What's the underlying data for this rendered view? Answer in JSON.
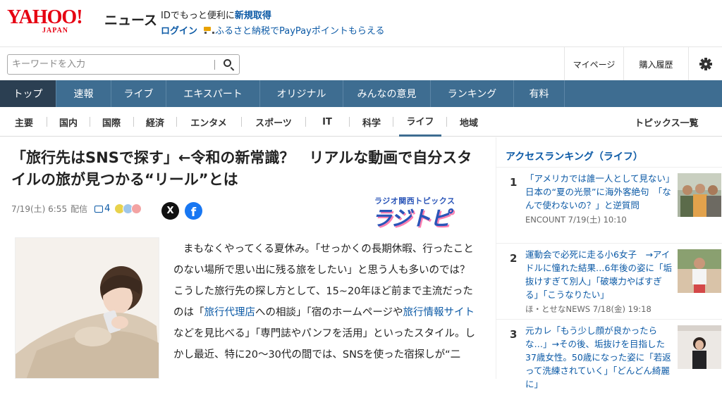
{
  "header": {
    "logo_main": "YAHOO!",
    "logo_sub": "JAPAN",
    "logo_section": "ニュース",
    "promo_prefix": "IDでもっと便利に",
    "promo_link": "新規取得",
    "login": "ログイン",
    "furusato": "ふるさと納税でPayPayポイントもらえる"
  },
  "search": {
    "placeholder": "キーワードを入力"
  },
  "utility": {
    "mypage": "マイページ",
    "history": "購入履歴",
    "settings_icon": "gear-icon"
  },
  "main_nav": [
    {
      "label": "トップ"
    },
    {
      "label": "速報"
    },
    {
      "label": "ライブ"
    },
    {
      "label": "エキスパート"
    },
    {
      "label": "オリジナル"
    },
    {
      "label": "みんなの意見"
    },
    {
      "label": "ランキング"
    },
    {
      "label": "有料"
    }
  ],
  "category_nav": [
    {
      "label": "主要"
    },
    {
      "label": "国内"
    },
    {
      "label": "国際"
    },
    {
      "label": "経済"
    },
    {
      "label": "エンタメ"
    },
    {
      "label": "スポーツ"
    },
    {
      "label": "IT"
    },
    {
      "label": "科学"
    },
    {
      "label": "ライフ"
    },
    {
      "label": "地域"
    }
  ],
  "topics_link": "トピックス一覧",
  "article": {
    "headline": "「旅行先はSNSで探す」←令和の新常識？　リアルな動画で自分スタイルの旅が見つかる“リール”とは",
    "date": "7/19(土) 6:55",
    "date_suffix": "配信",
    "comment_count": "4",
    "source_small": "ラジオ関西トピックス",
    "source_big": "ラジトピ",
    "body_parts": [
      "まもなくやってくる夏休み。「せっかくの長期休暇、行ったことのない場所で思い出に残る旅をしたい」と思う人も多いのでは？　こうした旅行先の探し方として、15~20年ほど前まで主流だったのは「",
      "旅行代理店",
      "への相談」「宿のホームページや",
      "旅行情報サイト",
      "などを見比べる」「専門誌やパンフを活用」といったスタイル。しかし最近、特に20～30代の間では、SNSを使った宿探しが“二"
    ]
  },
  "sidebar": {
    "title": "アクセスランキング（ライフ）",
    "items": [
      {
        "rank": "1",
        "title": "「アメリカでは誰一人として見ない」　日本の“夏の光景”に海外客絶句　「なんで使わないの？」と逆質問",
        "source": "ENCOUNT 7/19(土) 10:10"
      },
      {
        "rank": "2",
        "title": "運動会で必死に走る小6女子　→アイドルに憧れた結果…6年後の姿に「垢抜けすぎて別人」「破壊力やばすぎる」「こうなりたい」",
        "source": "ほ・とせなNEWS 7/18(金) 19:18"
      },
      {
        "rank": "3",
        "title": "元カレ「もう少し顔が良かったらな…」→その後、垢抜けを目指した37歳女性。50歳になった姿に「若返って洗練されていく」「どんどん綺麗に」",
        "source": ""
      }
    ]
  },
  "colors": {
    "brand_red": "#e60012",
    "nav_blue": "#3e6d91",
    "nav_active": "#2b3f52",
    "link_blue": "#0c5aa6"
  }
}
